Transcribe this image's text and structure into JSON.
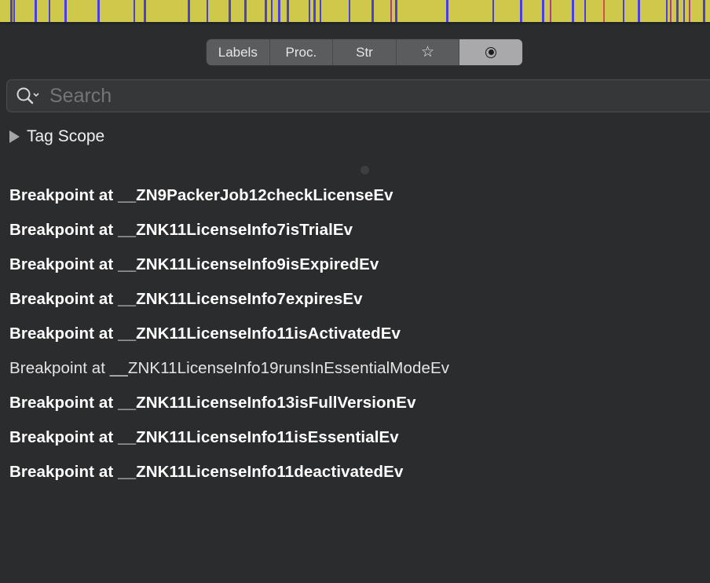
{
  "navigation_bar": {
    "background_color": "#cec94a",
    "marker_colors": [
      "#4b3fe0",
      "#b03a9a",
      "#d64a5a"
    ]
  },
  "segmented_control": {
    "tabs": [
      {
        "label": "Labels",
        "selected": false
      },
      {
        "label": "Proc.",
        "selected": false
      },
      {
        "label": "Str",
        "selected": false
      },
      {
        "label": "☆",
        "icon": "star-icon",
        "selected": false
      },
      {
        "label": "",
        "icon": "radio-button-icon",
        "selected": true
      }
    ]
  },
  "search": {
    "placeholder": "Search",
    "value": "",
    "icon": "search-icon"
  },
  "tag_scope": {
    "label": "Tag Scope",
    "expanded": false
  },
  "breakpoints": [
    {
      "label": "Breakpoint at __ZN9PackerJob12checkLicenseEv",
      "enabled": true
    },
    {
      "label": "Breakpoint at __ZNK11LicenseInfo7isTrialEv",
      "enabled": true
    },
    {
      "label": "Breakpoint at __ZNK11LicenseInfo9isExpiredEv",
      "enabled": true
    },
    {
      "label": "Breakpoint at __ZNK11LicenseInfo7expiresEv",
      "enabled": true
    },
    {
      "label": "Breakpoint at __ZNK11LicenseInfo11isActivatedEv",
      "enabled": true
    },
    {
      "label": "Breakpoint at __ZNK11LicenseInfo19runsInEssentialModeEv",
      "enabled": false
    },
    {
      "label": "Breakpoint at __ZNK11LicenseInfo13isFullVersionEv",
      "enabled": true
    },
    {
      "label": "Breakpoint at __ZNK11LicenseInfo11isEssentialEv",
      "enabled": true
    },
    {
      "label": "Breakpoint at __ZNK11LicenseInfo11deactivatedEv",
      "enabled": true
    }
  ]
}
